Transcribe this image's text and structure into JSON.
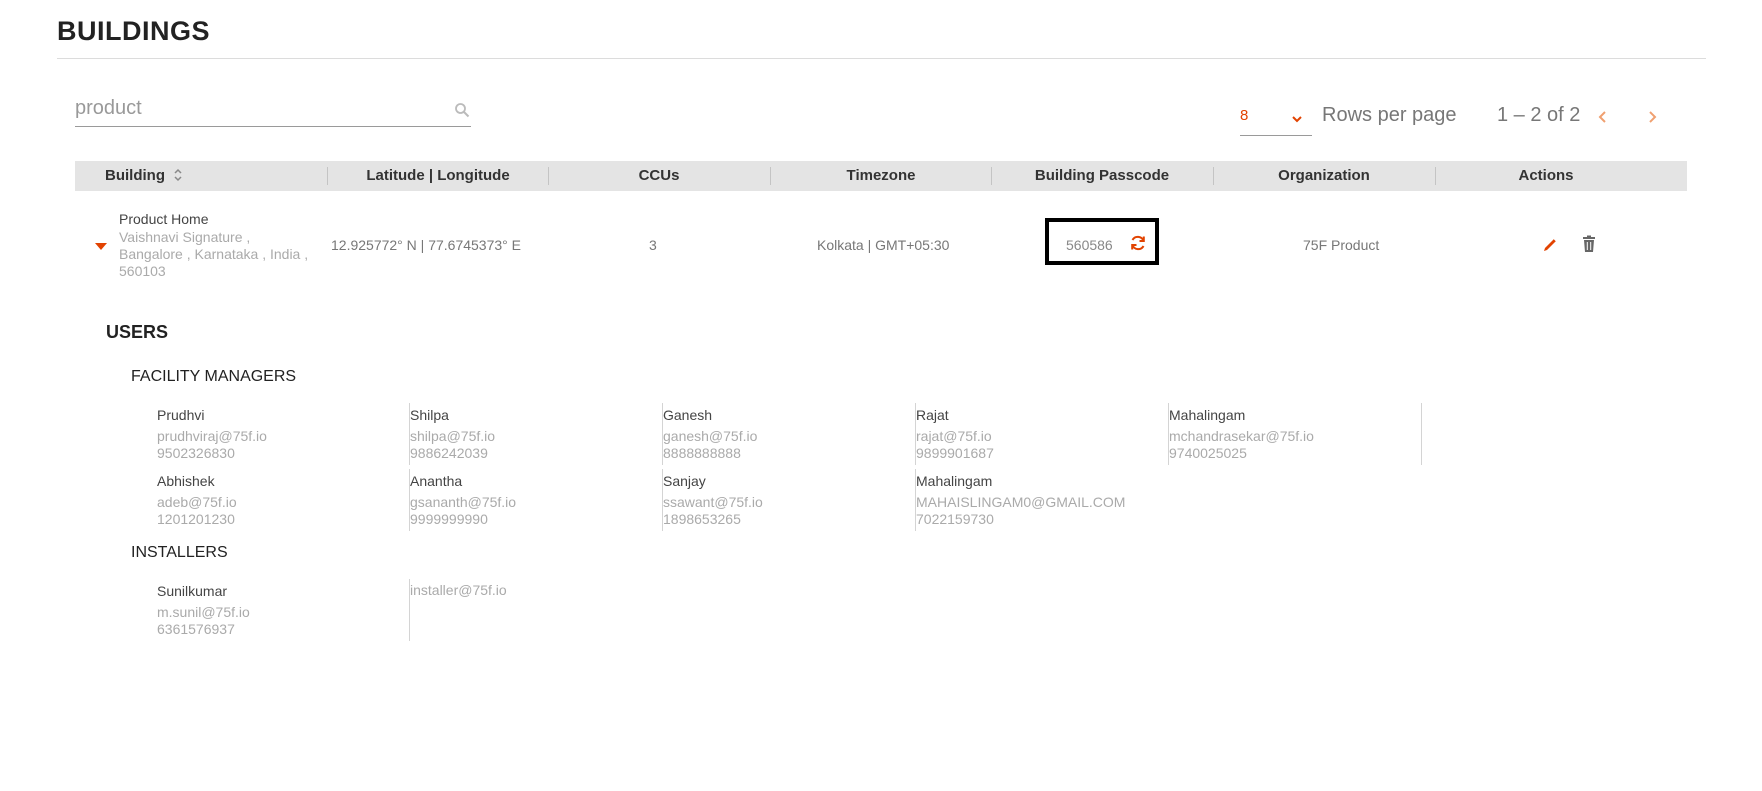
{
  "page": {
    "title": "BUILDINGS"
  },
  "search": {
    "value": "",
    "placeholder": "product"
  },
  "pagination": {
    "rows_per_page": "8",
    "rows_label": "Rows per page",
    "range": "1 – 2 of 2"
  },
  "table": {
    "headers": [
      "Building",
      "Latitude | Longitude",
      "CCUs",
      "Timezone",
      "Building Passcode",
      "Organization",
      "Actions"
    ]
  },
  "building": {
    "name": "Product Home",
    "address": "Vaishnavi Signature , Bangalore , Karnataka , India , 560103",
    "latlong": "12.925772° N | 77.6745373° E",
    "ccus": "3",
    "timezone": "Kolkata | GMT+05:30",
    "passcode": "560586",
    "organization": "75F Product"
  },
  "users": {
    "title": "USERS",
    "facility_managers_title": "FACILITY MANAGERS",
    "facility_managers": [
      {
        "name": "Prudhvi",
        "email": "prudhviraj@75f.io",
        "phone": "9502326830"
      },
      {
        "name": "Shilpa",
        "email": "shilpa@75f.io",
        "phone": "9886242039"
      },
      {
        "name": "Ganesh",
        "email": "ganesh@75f.io",
        "phone": "8888888888"
      },
      {
        "name": "Rajat",
        "email": "rajat@75f.io",
        "phone": "9899901687"
      },
      {
        "name": "Mahalingam",
        "email": "mchandrasekar@75f.io",
        "phone": "9740025025"
      },
      {
        "name": "Abhishek",
        "email": "adeb@75f.io",
        "phone": "1201201230"
      },
      {
        "name": "Anantha",
        "email": "gsananth@75f.io",
        "phone": "9999999990"
      },
      {
        "name": "Sanjay",
        "email": "ssawant@75f.io",
        "phone": "1898653265"
      },
      {
        "name": "Mahalingam",
        "email": "MAHAISLINGAM0@GMAIL.COM",
        "phone": "7022159730"
      }
    ],
    "installers_title": "INSTALLERS",
    "installers": [
      {
        "name": "Sunilkumar",
        "email": "m.sunil@75f.io",
        "phone": "6361576937"
      },
      {
        "name": "",
        "email": "installer@75f.io",
        "phone": ""
      }
    ]
  },
  "colors": {
    "accent": "#e24301",
    "header_bg": "#e4e4e4",
    "highlight_border": "#000000"
  },
  "icons": {
    "search": "search-icon",
    "dropdown": "chevron-down-icon",
    "prev": "chevron-left-icon",
    "next": "chevron-right-icon",
    "sort": "sort-icon",
    "expand": "caret-down-icon",
    "refresh": "refresh-icon",
    "edit": "pencil-icon",
    "delete": "trash-icon"
  }
}
